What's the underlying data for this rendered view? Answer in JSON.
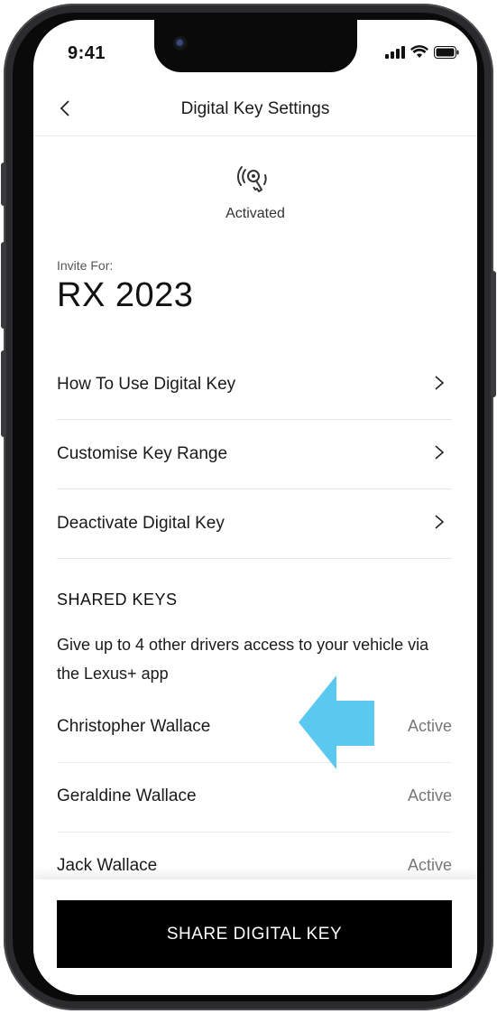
{
  "status_bar": {
    "time": "9:41",
    "icons": [
      "signal-icon",
      "wifi-icon",
      "battery-icon"
    ]
  },
  "nav": {
    "back_icon": "chevron-left-icon",
    "title": "Digital Key Settings"
  },
  "key_status": {
    "icon": "digital-key-icon",
    "label": "Activated"
  },
  "vehicle": {
    "invite_label": "Invite For:",
    "model": "RX 2023"
  },
  "menu": {
    "items": [
      {
        "label": "How To Use Digital Key",
        "icon": "chevron-right-icon"
      },
      {
        "label": "Customise Key Range",
        "icon": "chevron-right-icon"
      },
      {
        "label": "Deactivate Digital Key",
        "icon": "chevron-right-icon"
      }
    ]
  },
  "shared_keys": {
    "title": "SHARED KEYS",
    "description": "Give up to 4 other drivers access to your vehicle via the Lexus+ app",
    "drivers": [
      {
        "name": "Christopher Wallace",
        "status": "Active"
      },
      {
        "name": "Geraldine Wallace",
        "status": "Active"
      },
      {
        "name": "Jack Wallace",
        "status": "Active"
      }
    ]
  },
  "annotation": {
    "icon": "pointer-arrow-icon",
    "color": "#5BC8F0"
  },
  "footer": {
    "share_button": "SHARE DIGITAL KEY"
  },
  "colors": {
    "primary_button": "#000000",
    "button_text": "#FFFFFF",
    "annotation_arrow": "#5BC8F0"
  }
}
